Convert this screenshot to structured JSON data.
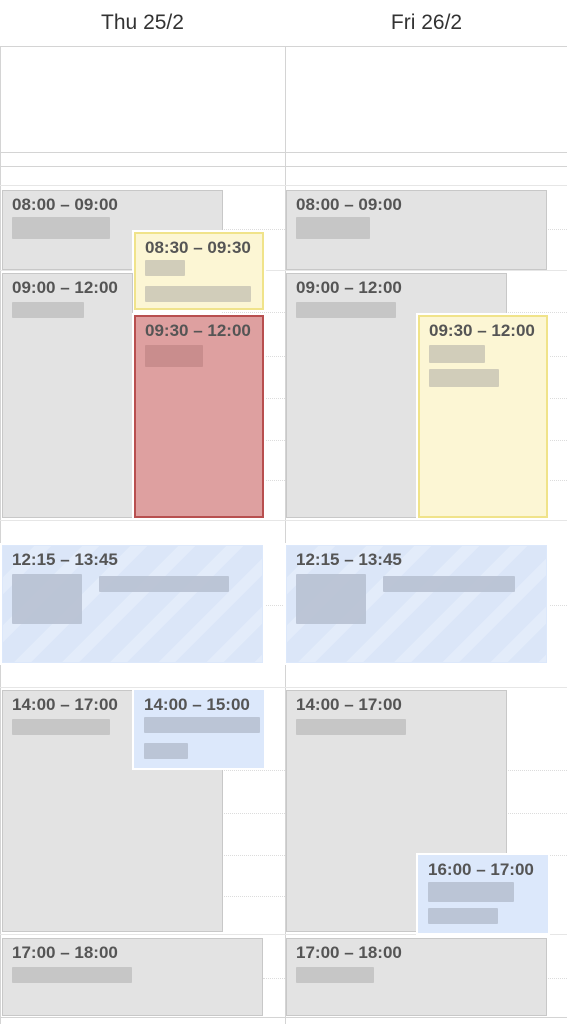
{
  "days": [
    {
      "label": "Thu 25/2"
    },
    {
      "label": "Fri 26/2"
    }
  ],
  "thu": {
    "e1": {
      "time": "08:00 – 09:00"
    },
    "e2": {
      "time": "08:30 – 09:30"
    },
    "e3": {
      "time": "09:00 – 12:00"
    },
    "e4": {
      "time": "09:30 – 12:00"
    },
    "e5": {
      "time": "12:15 – 13:45"
    },
    "e6": {
      "time": "14:00 – 17:00"
    },
    "e7": {
      "time": "14:00 – 15:00"
    },
    "e8": {
      "time": "17:00 – 18:00"
    }
  },
  "fri": {
    "e1": {
      "time": "08:00 – 09:00"
    },
    "e2": {
      "time": "09:00 – 12:00"
    },
    "e3": {
      "time": "09:30 – 12:00"
    },
    "e4": {
      "time": "12:15 – 13:45"
    },
    "e5": {
      "time": "14:00 – 17:00"
    },
    "e6": {
      "time": "16:00 – 17:00"
    },
    "e7": {
      "time": "17:00 – 18:00"
    }
  },
  "colors": {
    "gray_event": "#e3e3e3",
    "yellow_event": "#fcf6d4",
    "red_event": "#dea0a0",
    "blue_event": "#dce8fb"
  }
}
